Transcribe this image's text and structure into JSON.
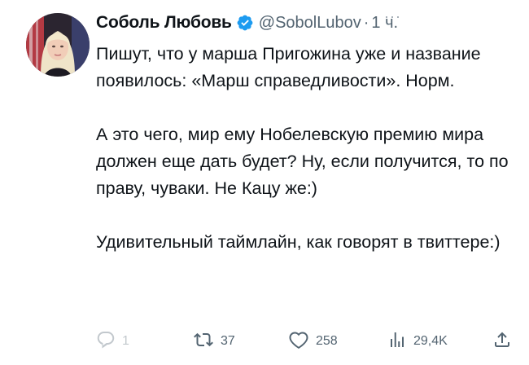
{
  "tweet": {
    "author_name": "Соболь Любовь",
    "handle": "@SobolLubov",
    "separator": "·",
    "time": "1 ч.",
    "more_label": "···",
    "paragraphs": [
      "Пишут, что у марша Пригожина уже и название появилось: «Марш справедливости». Норм.",
      "А это чего, мир ему Нобелевскую премию мира должен еще дать будет? Ну, если получится, то по праву, чуваки. Не Кацу же:)",
      "Удивительный таймлайн, как говорят в твиттере:)"
    ],
    "actions": {
      "reply_count": "1",
      "retweet_count": "37",
      "like_count": "258",
      "views_count": "29,4K"
    }
  },
  "colors": {
    "text_primary": "#0f1419",
    "text_secondary": "#536471",
    "verified_blue": "#1d9bf0"
  },
  "icons": {
    "verified": "verified-badge-icon",
    "reply": "reply-icon",
    "retweet": "retweet-icon",
    "like": "heart-icon",
    "views": "views-chart-icon",
    "share": "share-icon"
  }
}
